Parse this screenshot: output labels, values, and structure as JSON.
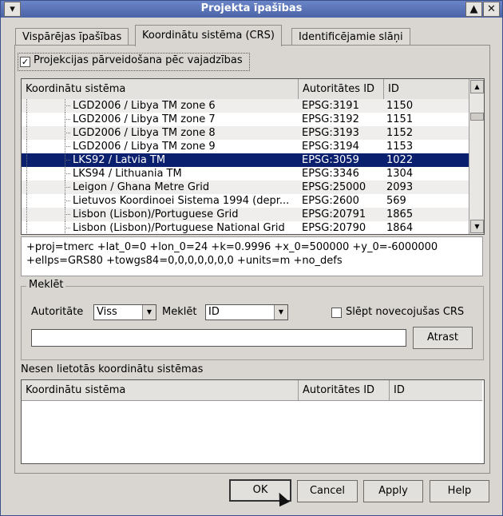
{
  "window": {
    "title": "Projekta īpašības"
  },
  "tabs": [
    {
      "label": "Vispārējas īpašības"
    },
    {
      "label": "Koordinātu sistēma (CRS)"
    },
    {
      "label": "Identificējamie slāņi"
    }
  ],
  "projection": {
    "label": "Projekcijas pārveidošana pēc vajadzības",
    "checked": true
  },
  "crs_table": {
    "headers": [
      "Koordinātu sistēma",
      "Autoritātes ID",
      "ID"
    ],
    "rows": [
      {
        "name": "LGD2006 / Libya TM zone 6",
        "auth": "EPSG:3191",
        "id": "1150"
      },
      {
        "name": "LGD2006 / Libya TM zone 7",
        "auth": "EPSG:3192",
        "id": "1151"
      },
      {
        "name": "LGD2006 / Libya TM zone 8",
        "auth": "EPSG:3193",
        "id": "1152"
      },
      {
        "name": "LGD2006 / Libya TM zone 9",
        "auth": "EPSG:3194",
        "id": "1153"
      },
      {
        "name": "LKS92 / Latvia TM",
        "auth": "EPSG:3059",
        "id": "1022"
      },
      {
        "name": "LKS94 / Lithuania TM",
        "auth": "EPSG:3346",
        "id": "1304"
      },
      {
        "name": "Leigon / Ghana Metre Grid",
        "auth": "EPSG:25000",
        "id": "2093"
      },
      {
        "name": "Lietuvos Koordinoei Sistema 1994 (depr...",
        "auth": "EPSG:2600",
        "id": "569"
      },
      {
        "name": "Lisbon (Lisbon)/Portuguese Grid",
        "auth": "EPSG:20791",
        "id": "1865"
      },
      {
        "name": "Lisbon (Lisbon)/Portuguese National Grid",
        "auth": "EPSG:20790",
        "id": "1864"
      }
    ],
    "selected_index": 4
  },
  "proj_string": {
    "line1": "+proj=tmerc +lat_0=0 +lon_0=24 +k=0.9996 +x_0=500000 +y_0=-6000000",
    "line2": "+ellps=GRS80 +towgs84=0,0,0,0,0,0,0 +units=m +no_defs"
  },
  "search": {
    "group_title": "Meklēt",
    "authority_label": "Autoritāte",
    "authority_value": "Viss",
    "search_label": "Meklēt",
    "search_value": "ID",
    "hide_deprecated_label": "Slēpt novecojušas CRS",
    "find_button": "Atrast",
    "input_value": ""
  },
  "recent": {
    "title": "Nesen lietotās koordinātu sistēmas",
    "headers": [
      "Koordinātu sistēma",
      "Autoritātes ID",
      "ID"
    ]
  },
  "buttons": {
    "ok": "OK",
    "cancel": "Cancel",
    "apply": "Apply",
    "help": "Help"
  },
  "titlebar_icons": {
    "menu": "▾",
    "minimize": "▲",
    "close": "✕"
  },
  "checkmark": "✓"
}
